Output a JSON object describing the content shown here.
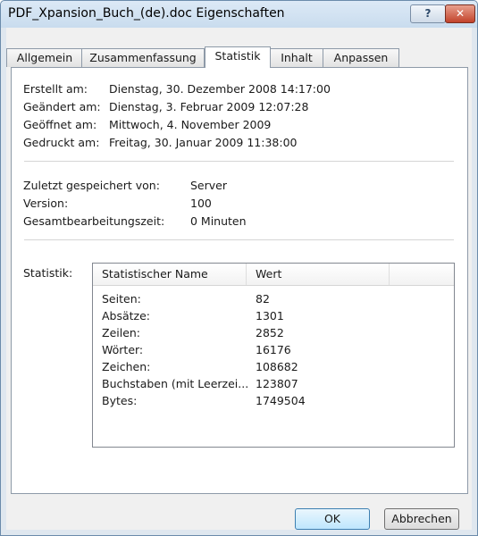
{
  "window": {
    "title": "PDF_Xpansion_Buch_(de).doc Eigenschaften",
    "help_label": "?",
    "close_label": "✕"
  },
  "tabs": [
    {
      "label": "Allgemein"
    },
    {
      "label": "Zusammenfassung"
    },
    {
      "label": "Statistik"
    },
    {
      "label": "Inhalt"
    },
    {
      "label": "Anpassen"
    }
  ],
  "dates": {
    "created_label": "Erstellt am:",
    "created_value": "Dienstag, 30. Dezember 2008 14:17:00",
    "modified_label": "Geändert am:",
    "modified_value": "Dienstag, 3. Februar 2009 12:07:28",
    "opened_label": "Geöffnet am:",
    "opened_value": "Mittwoch, 4. November 2009",
    "printed_label": "Gedruckt am:",
    "printed_value": "Freitag, 30. Januar 2009 11:38:00"
  },
  "info": {
    "saved_by_label": "Zuletzt gespeichert von:",
    "saved_by_value": "Server",
    "version_label": "Version:",
    "version_value": "100",
    "edit_time_label": "Gesamtbearbeitungszeit:",
    "edit_time_value": "0 Minuten"
  },
  "statistics": {
    "label": "Statistik:",
    "columns": [
      "Statistischer Name",
      "Wert"
    ],
    "rows": [
      {
        "name": "Seiten:",
        "value": "82"
      },
      {
        "name": "Absätze:",
        "value": "1301"
      },
      {
        "name": "Zeilen:",
        "value": "2852"
      },
      {
        "name": "Wörter:",
        "value": "16176"
      },
      {
        "name": "Zeichen:",
        "value": "108682"
      },
      {
        "name": "Buchstaben (mit Leerzei...",
        "value": "123807"
      },
      {
        "name": "Bytes:",
        "value": "1749504"
      }
    ]
  },
  "buttons": {
    "ok": "OK",
    "cancel": "Abbrechen"
  }
}
